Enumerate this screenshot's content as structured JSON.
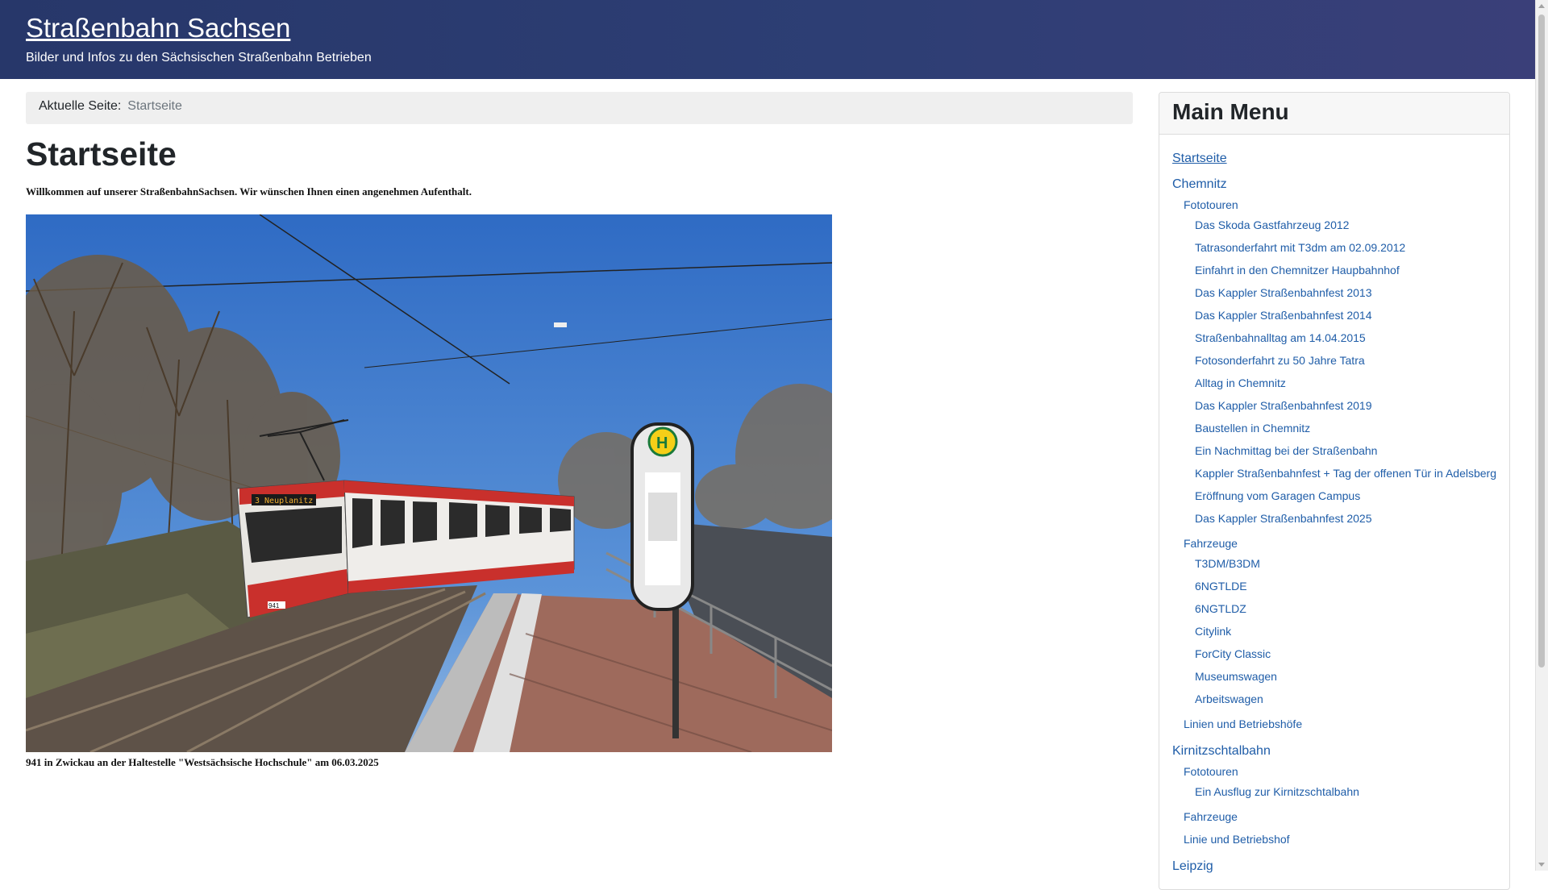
{
  "header": {
    "title": "Straßenbahn Sachsen",
    "subtitle": "Bilder und Infos zu den Sächsischen Straßenbahn Betrieben"
  },
  "breadcrumb": {
    "label": "Aktuelle Seite:",
    "current": "Startseite"
  },
  "main": {
    "title": "Startseite",
    "welcome": "Willkommen auf unserer StraßenbahnSachsen. Wir wünschen Ihnen einen angenehmen Aufenthalt.",
    "image_caption": "941 in Zwickau an der Haltestelle \"Westsächsische Hochschule\" am 06.03.2025",
    "tram_destination_sign": "3 Neuplanitz",
    "tram_number": "941",
    "stop_sign_letter": "H"
  },
  "menu": {
    "title": "Main Menu",
    "items": [
      {
        "label": "Startseite"
      },
      {
        "label": "Chemnitz"
      },
      {
        "label": "Fototouren"
      },
      {
        "label": "Das Skoda Gastfahrzeug 2012"
      },
      {
        "label": "Tatrasonderfahrt mit T3dm am 02.09.2012"
      },
      {
        "label": "Einfahrt in den Chemnitzer Haupbahnhof"
      },
      {
        "label": "Das Kappler Straßenbahnfest 2013"
      },
      {
        "label": "Das Kappler Straßenbahnfest 2014"
      },
      {
        "label": "Straßenbahnalltag am 14.04.2015"
      },
      {
        "label": "Fotosonderfahrt zu 50 Jahre Tatra"
      },
      {
        "label": "Alltag in Chemnitz"
      },
      {
        "label": "Das Kappler Straßenbahnfest 2019"
      },
      {
        "label": "Baustellen in Chemnitz"
      },
      {
        "label": "Ein Nachmittag bei der Straßenbahn"
      },
      {
        "label": "Kappler Straßenbahnfest + Tag der offenen Tür in Adelsberg"
      },
      {
        "label": "Eröffnung vom Garagen Campus"
      },
      {
        "label": "Das Kappler Straßenbahnfest 2025"
      },
      {
        "label": "Fahrzeuge"
      },
      {
        "label": "T3DM/B3DM"
      },
      {
        "label": "6NGTLDE"
      },
      {
        "label": "6NGTLDZ"
      },
      {
        "label": "Citylink"
      },
      {
        "label": "ForCity Classic"
      },
      {
        "label": "Museumswagen"
      },
      {
        "label": "Arbeitswagen"
      },
      {
        "label": "Linien und Betriebshöfe"
      },
      {
        "label": "Kirnitzschtalbahn"
      },
      {
        "label": "Fototouren"
      },
      {
        "label": "Ein Ausflug zur Kirnitzschtalbahn"
      },
      {
        "label": "Fahrzeuge"
      },
      {
        "label": "Linie und Betriebshof"
      },
      {
        "label": "Leipzig"
      }
    ]
  },
  "colors": {
    "header_bg": "#2d3e74",
    "link": "#1f5da8",
    "breadcrumb_bg": "#efefef"
  }
}
